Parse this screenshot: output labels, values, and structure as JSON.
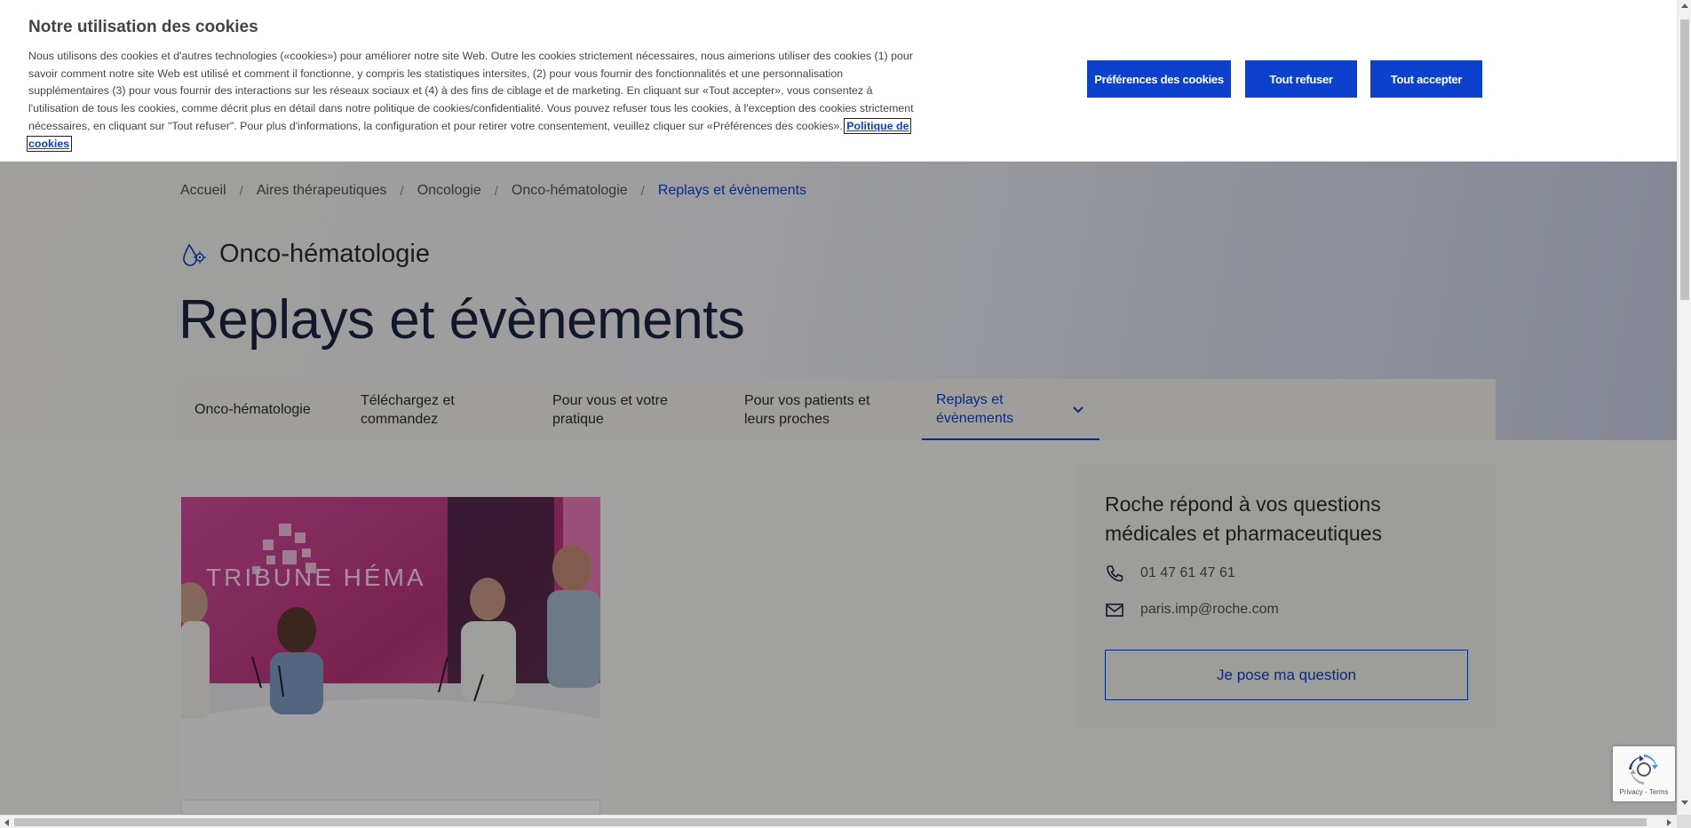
{
  "cookie_banner": {
    "title": "Notre utilisation des cookies",
    "text": "Nous utilisons des cookies et d'autres technologies («cookies») pour améliorer notre site Web. Outre les cookies strictement nécessaires, nous aimerions utiliser des cookies (1) pour savoir comment notre site Web est utilisé et comment il fonctionne, y compris les statistiques intersites, (2) pour vous fournir des fonctionnalités et une personnalisation supplémentaires (3) pour vous fournir des interactions sur les réseaux sociaux et (4) à des fins de ciblage et de marketing. En cliquant sur «Tout accepter», vous consentez à l'utilisation de tous les cookies, comme décrit plus en détail dans notre politique de cookies/confidentialité. Vous pouvez refuser tous les cookies, à l'exception des cookies strictement nécessaires, en cliquant sur \"Tout refuser\". Pour plus d'informations, la configuration et pour retirer votre consentement, veuillez cliquer sur «Préférences des cookies».",
    "policy_link": "Politique de cookies",
    "btn_preferences": "Préférences des cookies",
    "btn_refuse": "Tout refuser",
    "btn_accept": "Tout accepter"
  },
  "breadcrumb": {
    "items": [
      "Accueil",
      "Aires thérapeutiques",
      "Oncologie",
      "Onco-hématologie"
    ],
    "current": "Replays et évènements",
    "separator": "/"
  },
  "section": {
    "label": "Onco-hématologie",
    "icon": "onco-hematology-icon"
  },
  "page_title": "Replays et évènements",
  "subnav": {
    "items": [
      {
        "label": "Onco-hématologie"
      },
      {
        "label": "Téléchargez et commandez"
      },
      {
        "label": "Pour vous et votre pratique"
      },
      {
        "label": "Pour vos patients et leurs proches"
      },
      {
        "label": "Replays et évènements"
      }
    ]
  },
  "video_card": {
    "image_text": "TRIBUNE HÉMA"
  },
  "contact": {
    "title": "Roche répond à vos questions médicales et pharmaceutiques",
    "phone": "01 47 61 47 61",
    "email": "paris.imp@roche.com",
    "button": "Je pose ma question"
  },
  "recaptcha": {
    "text": "Privacy - Terms"
  },
  "colors": {
    "accent": "#0b41cd",
    "text": "#2b2b2b",
    "card_bg": "#efeeea"
  }
}
